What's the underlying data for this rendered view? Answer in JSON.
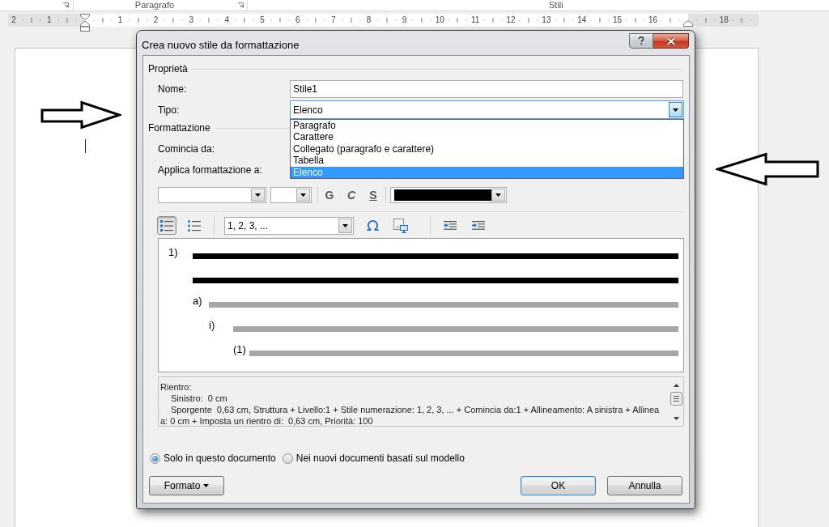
{
  "ribbon": {
    "groups": [
      {
        "label": "Paragrafo"
      },
      {
        "label": "Stili"
      }
    ]
  },
  "ruler": {
    "left_numbers": [
      "2",
      "1"
    ],
    "numbers": [
      "1",
      "2",
      "3",
      "4",
      "5",
      "6",
      "7",
      "8",
      "9",
      "10",
      "11",
      "12",
      "13",
      "14",
      "15",
      "16"
    ],
    "right_numbers": [
      "18"
    ]
  },
  "dialog": {
    "title": "Crea nuovo stile da formattazione",
    "properties": {
      "heading": "Proprietà",
      "name": {
        "label": "Nome:",
        "value": "Stile1"
      },
      "type": {
        "label": "Tipo:",
        "value": "Elenco",
        "expanded": true,
        "options": [
          {
            "label": "Paragrafo",
            "selected": false
          },
          {
            "label": "Carattere",
            "selected": false
          },
          {
            "label": "Collegato (paragrafo e carattere)",
            "selected": false
          },
          {
            "label": "Tabella",
            "selected": false
          },
          {
            "label": "Elenco",
            "selected": true
          }
        ]
      }
    },
    "formatting": {
      "heading": "Formattazione",
      "start_at": {
        "label": "Comincia da:"
      },
      "apply_to": {
        "label": "Applica formattazione a:"
      },
      "style_buttons": [
        {
          "label": "G",
          "kind": "bold",
          "pressed": false
        },
        {
          "label": "C",
          "kind": "italic",
          "pressed": false
        },
        {
          "label": "S",
          "kind": "underline",
          "pressed": false
        }
      ],
      "font_color": {
        "color": "#000000"
      },
      "list_buttons": [
        {
          "kind": "numbered",
          "pressed": true
        },
        {
          "kind": "bulleted",
          "pressed": false
        }
      ],
      "numbering_style": {
        "value": "1, 2, 3, ..."
      },
      "preview": {
        "items": [
          {
            "label": "1)",
            "kind": "current",
            "children": [
              {
                "label": "a)",
                "kind": "other",
                "children": [
                  {
                    "label": "i)",
                    "kind": "other",
                    "children": [
                      {
                        "label": "(1)",
                        "kind": "other"
                      }
                    ]
                  }
                ]
              }
            ]
          }
        ]
      },
      "description": {
        "lines": [
          {
            "kind": "heading",
            "text": "Rientro:"
          },
          {
            "kind": "indented",
            "text": "Sinistro:  0 cm"
          },
          {
            "kind": "indented",
            "text": "Sporgente  0,63 cm, Struttura + Livello:1 + Stile numerazione: 1, 2, 3, ... + Comincia da:1 + Allineamento: A sinistra + Allinea"
          },
          {
            "kind": "continuation",
            "text": "a: 0 cm + Imposta un rientro di:  0,63 cm, Priorità: 100"
          }
        ]
      }
    },
    "scope": [
      {
        "label": "Solo in questo documento",
        "selected": true
      },
      {
        "label": "Nei nuovi documenti basati sul modello",
        "selected": false
      }
    ],
    "format_button": {
      "label": "Formato"
    },
    "buttons": [
      {
        "label": "OK",
        "focused": true
      },
      {
        "label": "Annulla",
        "focused": false
      }
    ]
  }
}
